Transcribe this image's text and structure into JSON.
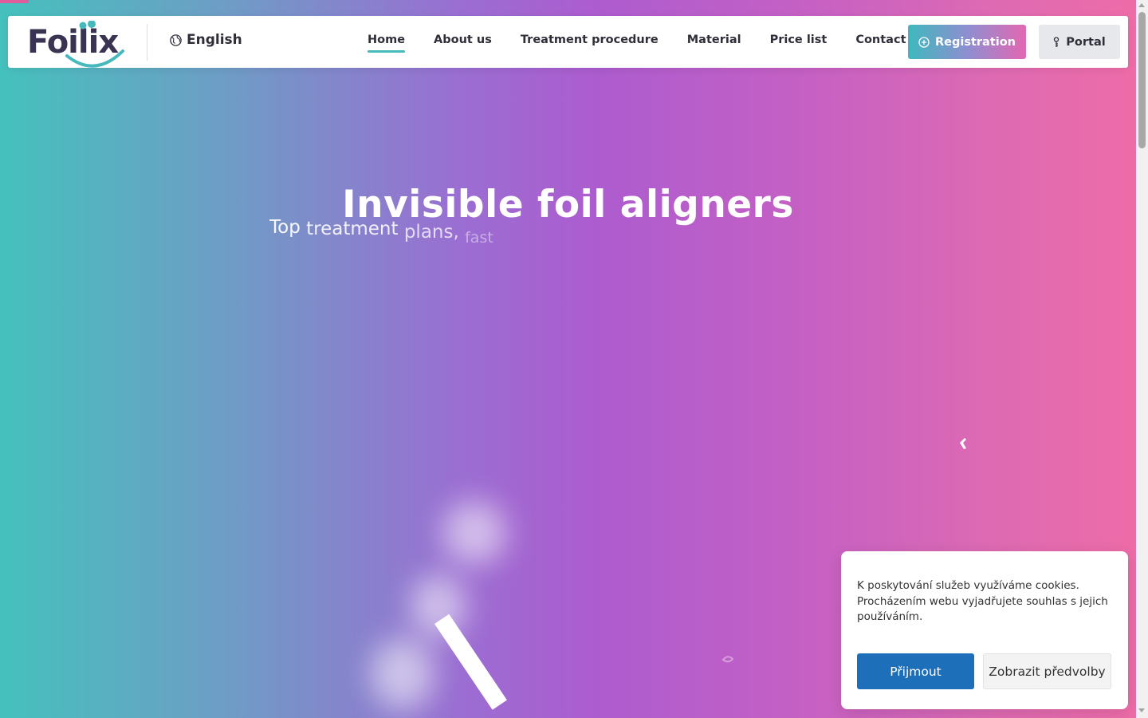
{
  "header": {
    "logo_text": "Foilix",
    "language": "English",
    "nav": [
      {
        "label": "Home",
        "active": true
      },
      {
        "label": "About us",
        "active": false
      },
      {
        "label": "Treatment procedure",
        "active": false
      },
      {
        "label": "Material",
        "active": false
      },
      {
        "label": "Price list",
        "active": false
      },
      {
        "label": "Contact",
        "active": false
      }
    ],
    "register_label": "Registration",
    "portal_label": "Portal",
    "icons": {
      "language": "globe-icon",
      "register": "plus-circle-icon",
      "portal": "key-icon"
    }
  },
  "hero": {
    "title": "Invisible foil aligners",
    "subtitle_words": [
      "Top",
      "treatment",
      "plans,",
      "fast"
    ]
  },
  "cookie": {
    "text": "K poskytování služeb využíváme cookies. Procházením webu vyjadřujete souhlas s jejich používáním.",
    "accept_label": "Přijmout",
    "prefs_label": "Zobrazit předvolby"
  },
  "colors": {
    "gradient_start": "#45c1bd",
    "gradient_mid": "#ad5ccf",
    "gradient_end": "#ef6ca7",
    "nav_active_underline": "#46b9bd",
    "accept_button": "#1e6fba",
    "logo_dark": "#3a3352",
    "logo_teal": "#46b9bd"
  }
}
